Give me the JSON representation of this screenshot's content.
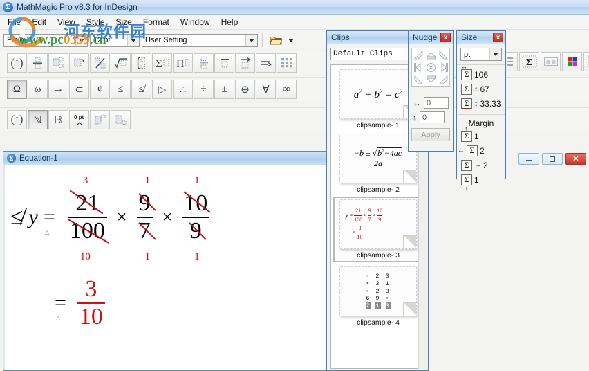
{
  "window": {
    "title": "MathMagic Pro v8.3 for InDesign",
    "icon": "sigma-app-icon"
  },
  "menubar": {
    "items": [
      "File",
      "Edit",
      "View",
      "Style",
      "Size",
      "Format",
      "Window",
      "Help"
    ]
  },
  "format_toolbar": {
    "style_value": "Plain",
    "size_value": "12 pt",
    "preset_value": "User Setting",
    "open_icon": "folder-open-icon",
    "dropdown_icon": "chevron-down-icon"
  },
  "palette_row1": [
    {
      "name": "fence-template",
      "glyph": "( )"
    },
    {
      "name": "fraction-template",
      "glyph": "frac"
    },
    {
      "name": "subscript-superscript-template",
      "glyph": "subsup"
    },
    {
      "name": "prime-template",
      "glyph": "prime"
    },
    {
      "name": "slash-fraction-template",
      "glyph": "slash"
    },
    {
      "name": "radical-template",
      "glyph": "sqrt"
    },
    {
      "name": "integral-template",
      "glyph": "int"
    },
    {
      "name": "summation-template",
      "glyph": "sum"
    },
    {
      "name": "product-template",
      "glyph": "prod"
    },
    {
      "name": "underover-template",
      "glyph": "underover"
    },
    {
      "name": "overbar-template",
      "glyph": "overbar"
    },
    {
      "name": "vector-arrow-template",
      "glyph": "vector"
    },
    {
      "name": "arrow-label-template",
      "glyph": "arrow"
    },
    {
      "name": "matrix-template",
      "glyph": "matrix"
    }
  ],
  "palette_row2": [
    {
      "name": "uppercase-greek-omega",
      "glyph": "Ω"
    },
    {
      "name": "lowercase-greek-omega",
      "glyph": "ω"
    },
    {
      "name": "right-arrow-symbol",
      "glyph": "→"
    },
    {
      "name": "subset-symbol",
      "glyph": "⊂"
    },
    {
      "name": "not-divides-symbol",
      "glyph": "¢"
    },
    {
      "name": "less-than-or-equal-symbol",
      "glyph": "≤"
    },
    {
      "name": "not-less-than-or-equal-symbol",
      "glyph": "≰"
    },
    {
      "name": "triangle-right-symbol",
      "glyph": "▷"
    },
    {
      "name": "therefore-symbol",
      "glyph": "∴"
    },
    {
      "name": "division-symbol",
      "glyph": "÷"
    },
    {
      "name": "plus-minus-symbol",
      "glyph": "±"
    },
    {
      "name": "circled-plus-symbol",
      "glyph": "⊕"
    },
    {
      "name": "for-all-symbol",
      "glyph": "∀"
    },
    {
      "name": "infinity-symbol",
      "glyph": "∞"
    }
  ],
  "palette_row3": [
    {
      "name": "fence-style-button",
      "glyph": "( )"
    },
    {
      "name": "blackboard-n-button",
      "glyph": "ℕ"
    },
    {
      "name": "blackboard-r-button",
      "glyph": "ℝ"
    },
    {
      "name": "zero-pt-spacing-button",
      "glyph": "0 pt"
    },
    {
      "name": "superscript-box-button",
      "glyph": "supbox"
    },
    {
      "name": "subscript-box-button",
      "glyph": "subbox"
    }
  ],
  "right_toolbar": [
    {
      "name": "list-view-button",
      "glyph": "list"
    },
    {
      "name": "insert-equation-button",
      "glyph": "sigma"
    },
    {
      "name": "two-pane-button",
      "glyph": "panes"
    },
    {
      "name": "color-palette-button",
      "glyph": "colors"
    },
    {
      "name": "move-tool-button",
      "glyph": "move"
    }
  ],
  "document_window": {
    "title": "Equation-1",
    "icon": "sigma-doc-icon",
    "controls": {
      "minimize": "minimize-button",
      "restore": "restore-button",
      "close": "close-button"
    },
    "equation": {
      "line1": {
        "lead_symbol": "≰",
        "variable": "y",
        "relation": "=",
        "terms": [
          {
            "numerator": "21",
            "denominator": "100",
            "cancel_numerator": "3",
            "cancel_denominator": "10"
          },
          {
            "numerator": "9",
            "denominator": "7",
            "cancel_numerator": "1",
            "cancel_denominator": "1"
          },
          {
            "numerator": "10",
            "denominator": "9",
            "cancel_numerator": "1",
            "cancel_denominator": "1"
          }
        ],
        "operator": "×"
      },
      "line2": {
        "relation": "=",
        "result": {
          "numerator": "3",
          "denominator": "10"
        }
      },
      "cancel_color": "#cf1111"
    }
  },
  "clips_panel": {
    "title": "Clips",
    "close_label": "x",
    "set_value": "Default Clips",
    "items": [
      {
        "label": "clipsample- 1",
        "preview": "a² + b² = c²",
        "selected": false
      },
      {
        "label": "clipsample- 2",
        "preview": "quadratic-formula",
        "selected": false
      },
      {
        "label": "clipsample- 3",
        "preview": "fraction-cancellation",
        "selected": true
      },
      {
        "label": "clipsample- 4",
        "preview": "long-multiplication",
        "selected": false
      }
    ]
  },
  "nudge_panel": {
    "title": "Nudge",
    "close_label": "x",
    "horizontal_value": "0",
    "vertical_value": "0",
    "apply_label": "Apply",
    "directions": [
      "nudge-up-left",
      "nudge-up",
      "nudge-up-right",
      "nudge-left",
      "nudge-reset",
      "nudge-right",
      "nudge-down-left",
      "nudge-down",
      "nudge-down-right"
    ]
  },
  "size_panel": {
    "title": "Size",
    "close_label": "x",
    "unit_value": "pt",
    "width_value": "106",
    "height_value": "67",
    "baseline_value": "33.33",
    "margin_label": "Margin",
    "margin_top": "1",
    "margin_left": "2",
    "margin_right": "2",
    "margin_bottom": "1"
  },
  "watermark": {
    "chinese": "河东软件园",
    "url_part1": "www.pc",
    "url_part2": "0359",
    "url_part3": ".cn"
  }
}
